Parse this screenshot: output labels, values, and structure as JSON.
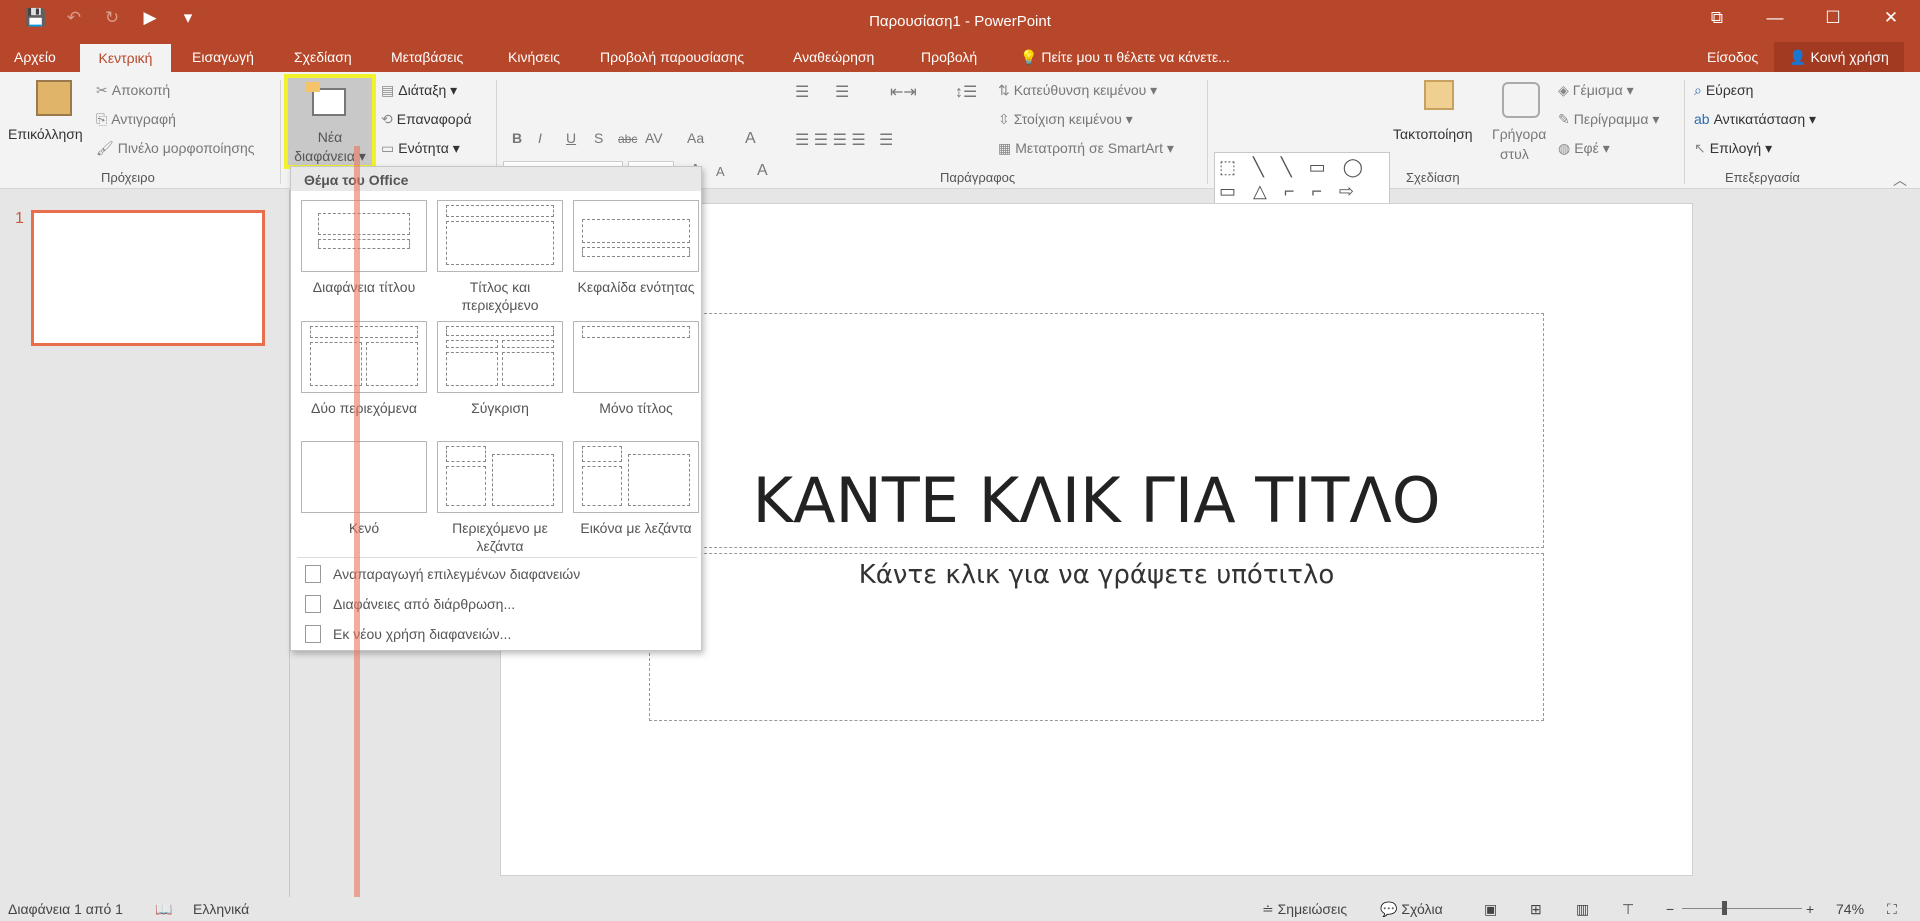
{
  "title": "Παρουσίαση1 - PowerPoint",
  "qat": {
    "save": "💾",
    "undo": "↶",
    "redo": "↻",
    "present": "▶",
    "more": "▾"
  },
  "win": {
    "restore": "⧉",
    "min": "—",
    "max": "☐",
    "close": "✕"
  },
  "tabs": [
    "Αρχείο",
    "Κεντρική",
    "Εισαγωγή",
    "Σχεδίαση",
    "Μεταβάσεις",
    "Κινήσεις",
    "Προβολή παρουσίασης",
    "Αναθεώρηση",
    "Προβολή"
  ],
  "tellme": "Πείτε μου τι θέλετε να κάνετε...",
  "signin": "Είσοδος",
  "share": "Κοινή χρήση",
  "clipboard": {
    "paste": "Επικόλληση",
    "cut": "Αποκοπή",
    "copy": "Αντιγραφή",
    "format_painter": "Πινέλο μορφοποίησης",
    "group": "Πρόχειρο"
  },
  "slides": {
    "new_line1": "Νέα",
    "new_line2": "διαφάνεια",
    "layout": "Διάταξη",
    "reset": "Επαναφορά",
    "section": "Ενότητα"
  },
  "font": {
    "grow": "A",
    "shrink": "A",
    "clear": "A",
    "bold": "B",
    "italic": "I",
    "underline": "U",
    "shadow": "S",
    "strike": "abc",
    "spacing": "AV",
    "case": "Aa",
    "color": "A"
  },
  "paragraph": {
    "text_direction": "Κατεύθυνση κειμένου",
    "align_text": "Στοίχιση κειμένου",
    "smartart": "Μετατροπή σε SmartArt",
    "group": "Παράγραφος"
  },
  "drawing": {
    "shapes": "⬚ ╲ ╲ ▭ ◯ ▭ △ ⌐ ⌐ ⇨ ⇩ ◻ ↝ ⌒ ∿ { } ☆",
    "arrange": "Τακτοποίηση",
    "quick1": "Γρήγορα",
    "quick2": "στυλ",
    "fill": "Γέμισμα",
    "outline": "Περίγραμμα",
    "effects": "Εφέ",
    "group": "Σχεδίαση"
  },
  "editing": {
    "find": "Εύρεση",
    "replace": "Αντικατάσταση",
    "select": "Επιλογή",
    "group": "Επεξεργασία"
  },
  "dropdown": {
    "header": "Θέμα του Office",
    "layouts": [
      {
        "name": "Διαφάνεια τίτλου"
      },
      {
        "name": "Τίτλος και περιεχόμενο"
      },
      {
        "name": "Κεφαλίδα ενότητας"
      },
      {
        "name": "Δύο περιεχόμενα"
      },
      {
        "name": "Σύγκριση"
      },
      {
        "name": "Μόνο τίτλος"
      },
      {
        "name": "Κενό"
      },
      {
        "name": "Περιεχόμενο με λεζάντα"
      },
      {
        "name": "Εικόνα με λεζάντα"
      }
    ],
    "actions": [
      "Αναπαραγωγή επιλεγμένων διαφανειών",
      "Διαφάνειες από διάρθρωση...",
      "Εκ νέου χρήση διαφανειών..."
    ]
  },
  "slide_number": "1",
  "slide": {
    "title": "ΚΑΝΤΕ ΚΛΙΚ ΓΙΑ ΤΙΤΛΟ",
    "subtitle": "Κάντε κλικ για να γράψετε υπότιτλο"
  },
  "status": {
    "slide": "Διαφάνεια 1 από 1",
    "language": "Ελληνικά",
    "notes": "Σημειώσεις",
    "comments": "Σχόλια",
    "zoom": "74%"
  }
}
